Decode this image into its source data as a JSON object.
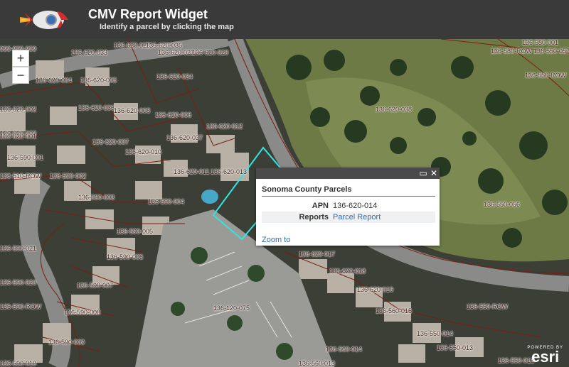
{
  "app": {
    "title": "CMV Report Widget",
    "subtitle": "Identify a parcel by clicking the map"
  },
  "zoom": {
    "in": "+",
    "out": "−"
  },
  "popup": {
    "title": "Sonoma County Parcels",
    "maximize_icon": "maximize-icon",
    "close_icon": "close-icon",
    "rows": [
      {
        "key": "APN",
        "value": "136-620-014"
      },
      {
        "key": "Reports",
        "value": "Parcel Report"
      }
    ],
    "zoom_to": "Zoom to"
  },
  "attribution": {
    "powered_by": "POWERED BY",
    "brand": "esri"
  },
  "parcel_labels": [
    "999-999-999",
    "136-620-033",
    "136-620-023",
    "136-620-035",
    "136-620-021",
    "136-620-020",
    "136-620-004",
    "136-620-005",
    "136-620-034",
    "136-620-002",
    "136-620-036",
    "136-620-008",
    "136-620-006",
    "136-620-003",
    "136-620-001",
    "136-620-007",
    "136-620-037",
    "136-620-012",
    "136-590-001",
    "136-620-010",
    "136-620-011",
    "136-620-013",
    "136-510-ROW",
    "136-590-002",
    "136-590-003",
    "136-590-004",
    "136-590-005",
    "136-590-021",
    "136-590-006",
    "136-590-020",
    "136-590-007",
    "136-590-ROW",
    "136-590-008",
    "136-590-009",
    "136-590-010",
    "136-620-038",
    "136-620-017",
    "136-620-018",
    "136-620-019",
    "136-120-075",
    "136-560-014",
    "136-560-013",
    "136-560-015",
    "136-550-014",
    "136-550-013",
    "136-550-012",
    "136-550-ROW",
    "136-550-056",
    "136-580-001",
    "136-580-ROW",
    "136-550-057",
    "136-550-ROW"
  ]
}
